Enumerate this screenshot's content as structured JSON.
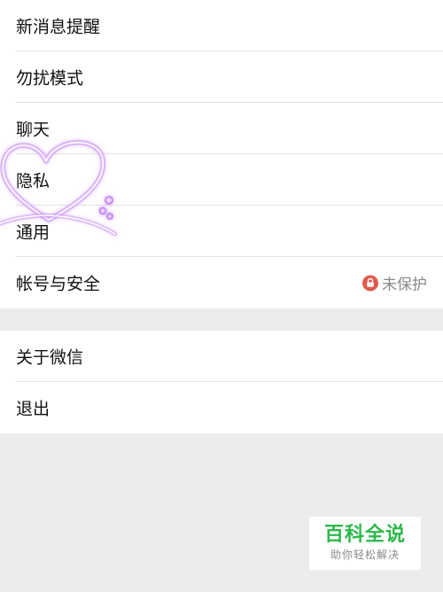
{
  "settings": {
    "group1": [
      {
        "label": "新消息提醒"
      },
      {
        "label": "勿扰模式"
      },
      {
        "label": "聊天"
      },
      {
        "label": "隐私"
      },
      {
        "label": "通用"
      },
      {
        "label": "帐号与安全",
        "value": "未保护",
        "value_icon": "lock-icon"
      }
    ],
    "group2": [
      {
        "label": "关于微信"
      },
      {
        "label": "退出"
      }
    ]
  },
  "watermark": {
    "title": "百科全说",
    "subtitle": "助你轻松解决"
  },
  "colors": {
    "background": "#ececec",
    "panel": "#ffffff",
    "warning": "#e05a4e",
    "brand_green": "#2db84a"
  }
}
